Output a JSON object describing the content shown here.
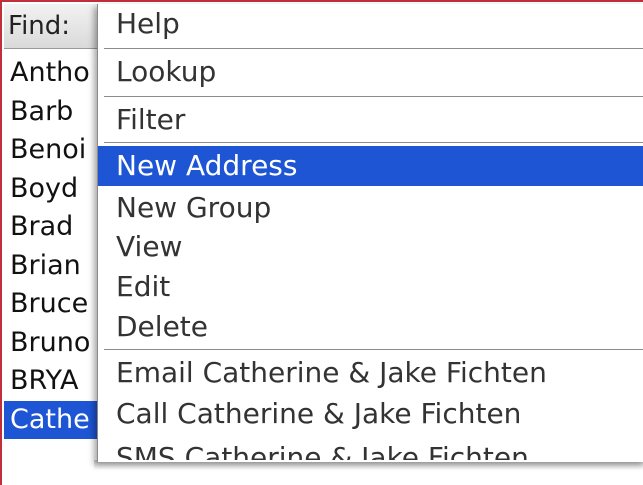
{
  "find_bar": {
    "label": "Find:"
  },
  "contacts": [
    {
      "label": "Antho",
      "selected": false
    },
    {
      "label": "Barb",
      "selected": false
    },
    {
      "label": "Benoi",
      "selected": false
    },
    {
      "label": "Boyd",
      "selected": false
    },
    {
      "label": "Brad",
      "selected": false
    },
    {
      "label": "Brian",
      "selected": false
    },
    {
      "label": "Bruce",
      "selected": false
    },
    {
      "label": "Bruno",
      "selected": false
    },
    {
      "label": "BRYA",
      "selected": false
    },
    {
      "label": "Cathe",
      "selected": true
    }
  ],
  "menu": {
    "items": [
      {
        "label": "Help",
        "selected": false
      },
      {
        "label": "Lookup",
        "selected": false
      },
      {
        "label": "Filter",
        "selected": false
      },
      {
        "label": "New Address",
        "selected": true
      },
      {
        "label": "New Group",
        "selected": false
      },
      {
        "label": "View",
        "selected": false
      },
      {
        "label": "Edit",
        "selected": false
      },
      {
        "label": "Delete",
        "selected": false
      },
      {
        "label": "Email Catherine & Jake Fichten",
        "selected": false
      },
      {
        "label": "Call Catherine & Jake Fichten",
        "selected": false
      },
      {
        "label": "SMS Catherine & Jake Fichten",
        "selected": false
      }
    ]
  },
  "colors": {
    "selection": "#1d55d4",
    "frame": "#c0303a"
  }
}
